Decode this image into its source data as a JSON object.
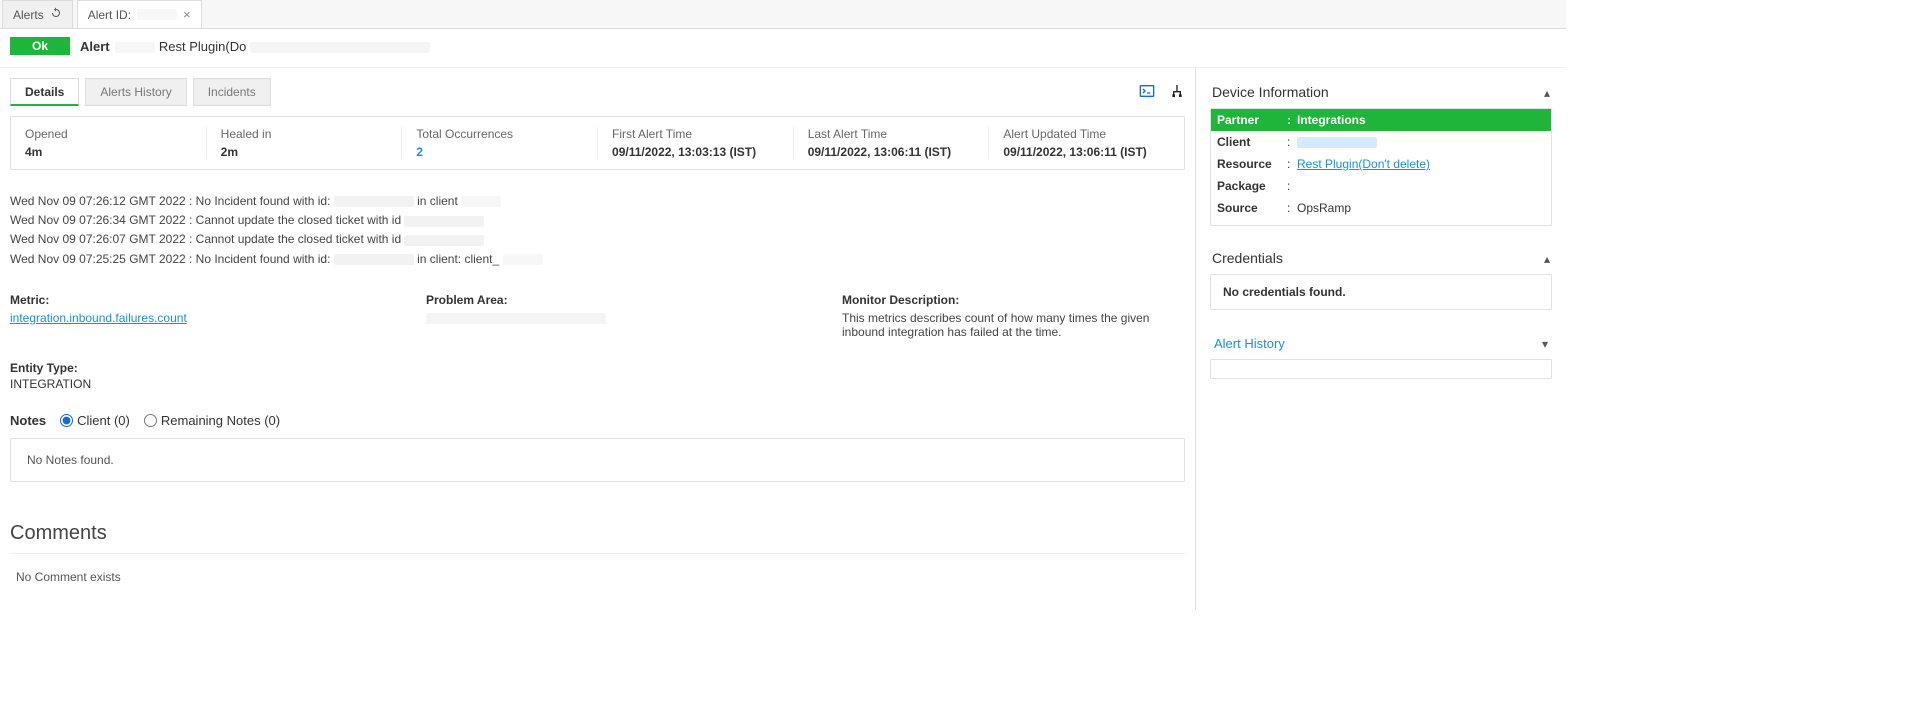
{
  "topTabs": {
    "alerts": "Alerts",
    "alertIdPrefix": "Alert ID:"
  },
  "status": {
    "badge": "Ok",
    "alertLabel": "Alert",
    "definitionSuffix": "Rest Plugin(Do"
  },
  "innerTabs": {
    "details": "Details",
    "history": "Alerts History",
    "incidents": "Incidents"
  },
  "summary": {
    "opened": {
      "label": "Opened",
      "value": "4m"
    },
    "healed": {
      "label": "Healed in",
      "value": "2m"
    },
    "occurrences": {
      "label": "Total Occurrences",
      "value": "2"
    },
    "firstTime": {
      "label": "First Alert Time",
      "value": "09/11/2022, 13:03:13 (IST)"
    },
    "lastTime": {
      "label": "Last Alert Time",
      "value": "09/11/2022, 13:06:11 (IST)"
    },
    "updatedTime": {
      "label": "Alert Updated Time",
      "value": "09/11/2022, 13:06:11 (IST)"
    }
  },
  "log": [
    {
      "prefix": "Wed Nov 09 07:26:12 GMT 2022 : No Incident found with id:",
      "suffix": "in client"
    },
    {
      "prefix": "Wed Nov 09 07:26:34 GMT 2022 : Cannot update the closed ticket with id",
      "suffix": ""
    },
    {
      "prefix": "Wed Nov 09 07:26:07 GMT 2022 : Cannot update the closed ticket with id",
      "suffix": ""
    },
    {
      "prefix": "Wed Nov 09 07:25:25 GMT 2022 : No Incident found with id:",
      "suffix": "in client: client_"
    }
  ],
  "details": {
    "metric": {
      "label": "Metric:",
      "value": "integration.inbound.failures.count"
    },
    "problemArea": {
      "label": "Problem Area:",
      "value": ""
    },
    "monitorDesc": {
      "label": "Monitor Description:",
      "value": "This metrics describes count of how many times the given inbound integration has failed at the time."
    },
    "entityType": {
      "label": "Entity Type:",
      "value": "INTEGRATION"
    }
  },
  "notes": {
    "title": "Notes",
    "clientOpt": "Client (0)",
    "remainingOpt": "Remaining Notes (0)",
    "empty": "No Notes found."
  },
  "comments": {
    "title": "Comments",
    "empty": "No Comment exists"
  },
  "deviceInfo": {
    "title": "Device Information",
    "rows": {
      "partner": {
        "k": "Partner",
        "v": "Integrations"
      },
      "client": {
        "k": "Client",
        "v": ""
      },
      "resource": {
        "k": "Resource",
        "v": "Rest Plugin(Don't delete)"
      },
      "package": {
        "k": "Package",
        "v": ""
      },
      "source": {
        "k": "Source",
        "v": "OpsRamp"
      }
    }
  },
  "credentials": {
    "title": "Credentials",
    "empty": "No credentials found."
  },
  "alertHistory": {
    "title": "Alert History"
  }
}
